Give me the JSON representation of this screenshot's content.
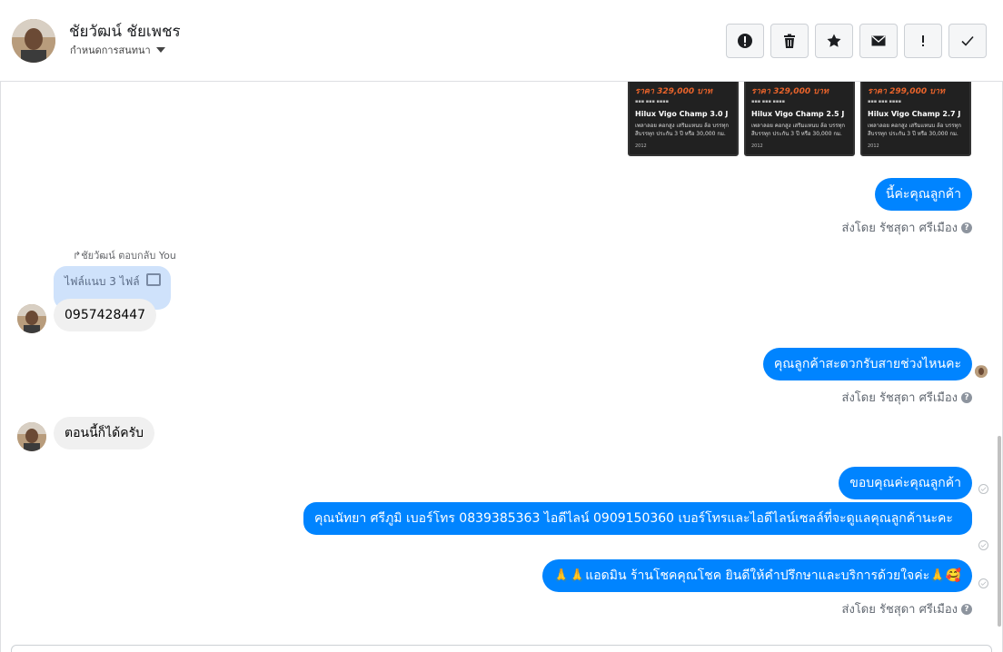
{
  "header": {
    "contact_name": "ชัยวัฒน์ ชัยเพชร",
    "assign_label": "กำหนดการสนทนา",
    "toolbar": [
      {
        "name": "spam-icon",
        "label": "Mark as spam"
      },
      {
        "name": "trash-icon",
        "label": "Delete"
      },
      {
        "name": "star-icon",
        "label": "Star"
      },
      {
        "name": "envelope-icon",
        "label": "Mark unread"
      },
      {
        "name": "exclamation-icon",
        "label": "Follow up"
      },
      {
        "name": "check-icon",
        "label": "Mark done"
      }
    ]
  },
  "cards": [
    {
      "price": "ราคา 329,000 บาท",
      "model": "Hilux Vigo Champ 3.0 J",
      "desc": "เพลาลอย คอกสูง เสริมแหนบ ล้อ บรรทุก สีบรรทุก ประกัน 3 ปี หรือ 30,000 กม.",
      "year": "2012"
    },
    {
      "price": "ราคา 329,000 บาท",
      "model": "Hilux Vigo Champ 2.5 J",
      "desc": "เพลาลอย คอกสูง เสริมแหนบ ล้อ บรรทุก สีบรรทุก ประกัน 3 ปี หรือ 30,000 กม.",
      "year": "2012"
    },
    {
      "price": "ราคา 299,000 บาท",
      "model": "Hilux Vigo Champ 2.7 J",
      "desc": "เพลาลอย คอกสูง เสริมแหนบ ล้อ บรรทุก สีบรรทุก ประกัน 3 ปี หรือ 30,000 กม.",
      "year": "2012"
    }
  ],
  "messages": {
    "out_1": "นี้ค่ะคุณลูกค้า",
    "sent_by": "ส่งโดย รัชสุดา ศรีเมือง",
    "reply_note": "ชัยวัฒน์ ตอบกลับ You",
    "reply_quote": "ไฟล์แนบ 3 ไฟล์",
    "in_phone": "0957428447",
    "out_2": "คุณลูกค้าสะดวกรับสายช่วงไหนคะ",
    "in_2": "ตอนนี้ก็ได้ครับ",
    "out_3": "ขอบคุณค่ะคุณลูกค้า",
    "out_4": "คุณนัทยา ศรีภูมิ      เบอร์โทร 0839385363  ไอดีไลน์ 0909150360   เบอร์โทรและไอดีไลน์เซลล์ที่จะดูแลคุณลูกค้านะคะ",
    "out_5": "🙏🙏แอดมิน ร้านโชคคุณโชค ยินดีให้คำปรึกษาและบริการด้วยใจค่ะ🙏🥰"
  },
  "colors": {
    "accent": "#0084ff",
    "incoming": "#f0f0f0",
    "card_bg": "#212121",
    "price": "#e8632b"
  }
}
